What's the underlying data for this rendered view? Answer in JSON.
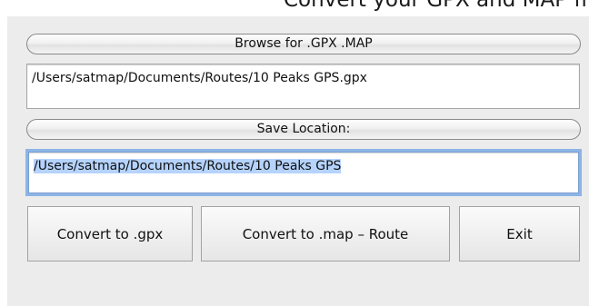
{
  "header": {
    "clipped_text": "Convert your GPX and MAP files"
  },
  "browse": {
    "button_label": "Browse for .GPX .MAP",
    "input_path": "/Users/satmap/Documents/Routes/10 Peaks GPS.gpx"
  },
  "save": {
    "button_label": "Save Location:",
    "output_path": "/Users/satmap/Documents/Routes/10 Peaks GPS"
  },
  "actions": {
    "convert_gpx_label": "Convert to .gpx",
    "convert_map_label": "Convert to .map – Route",
    "exit_label": "Exit"
  },
  "colors": {
    "panel_background": "#ececec",
    "focus_ring": "#8db4e6",
    "selection_highlight": "#b5d3fc"
  }
}
